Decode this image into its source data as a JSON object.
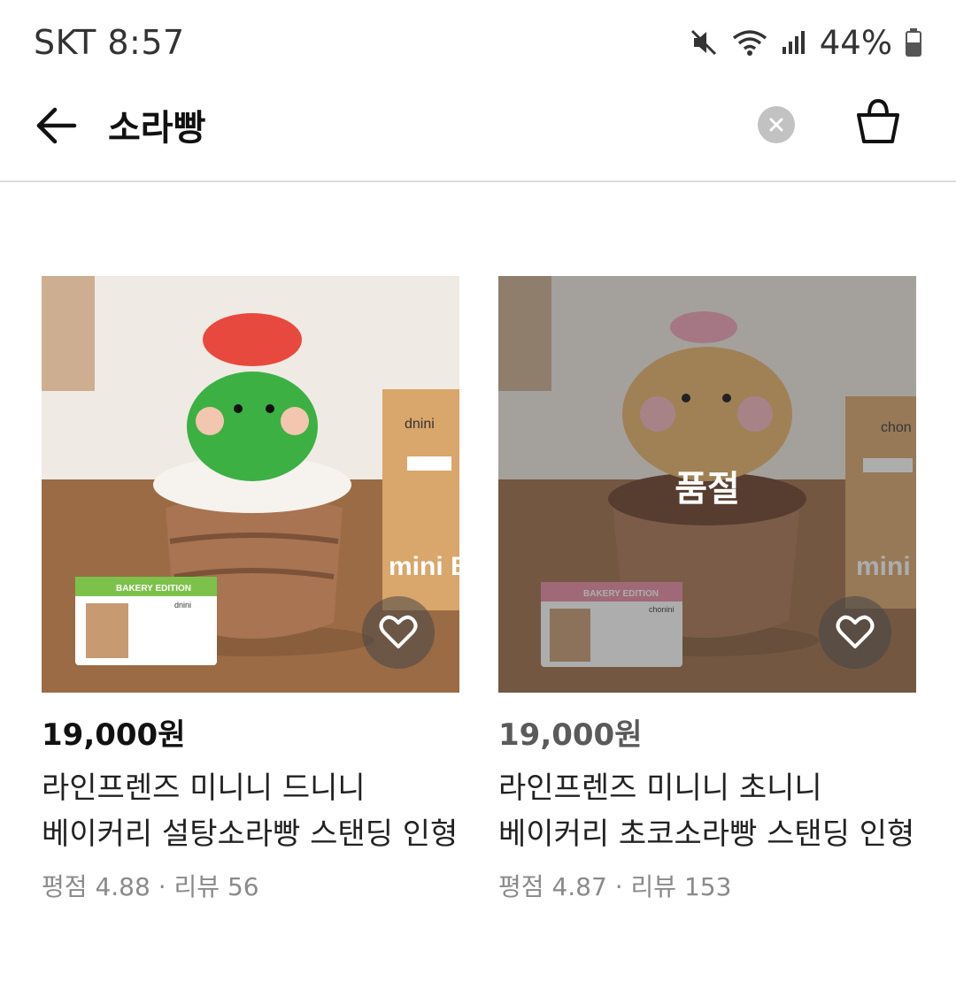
{
  "status_bar": {
    "carrier_time": "SKT 8:57",
    "battery_percent": "44%",
    "icons": [
      "mute-icon",
      "wifi-icon",
      "signal-icon",
      "battery-icon"
    ]
  },
  "header": {
    "search_query": "소라빵",
    "icons": [
      "back-arrow-icon",
      "clear-icon",
      "shopping-bag-icon"
    ]
  },
  "products": [
    {
      "price": "19,000원",
      "title": "라인프렌즈 미니니 드니니 베이커리 설탕소라빵 스탠딩 인형",
      "rating_label": "평점",
      "rating": "4.88",
      "review_label": "리뷰",
      "review_count": "56",
      "sold_out": false,
      "box_text": "dnini",
      "box_brand": "mini BAK",
      "card_name": "dnini",
      "card_edition": "BAKERY EDITION",
      "card_accent": "#7cc24a",
      "plush_color": "#3cb043",
      "hat_color": "#e8493f"
    },
    {
      "price": "19,000원",
      "title": "라인프렌즈 미니니 초니니 베이커리 초코소라빵 스탠딩 인형",
      "rating_label": "평점",
      "rating": "4.87",
      "review_label": "리뷰",
      "review_count": "153",
      "sold_out": true,
      "sold_out_label": "품절",
      "box_text": "chon",
      "box_brand": "mini BAK",
      "card_name": "chonini",
      "card_edition": "BAKERY EDITION",
      "card_accent": "#e98ba6",
      "plush_color": "#e8b46a",
      "hat_color": "#f2a3b8"
    }
  ],
  "separator": "·",
  "colors": {
    "divider": "#dcdcdc",
    "meta_text": "#8a8a8a",
    "clear_button": "#c2c2c2"
  }
}
